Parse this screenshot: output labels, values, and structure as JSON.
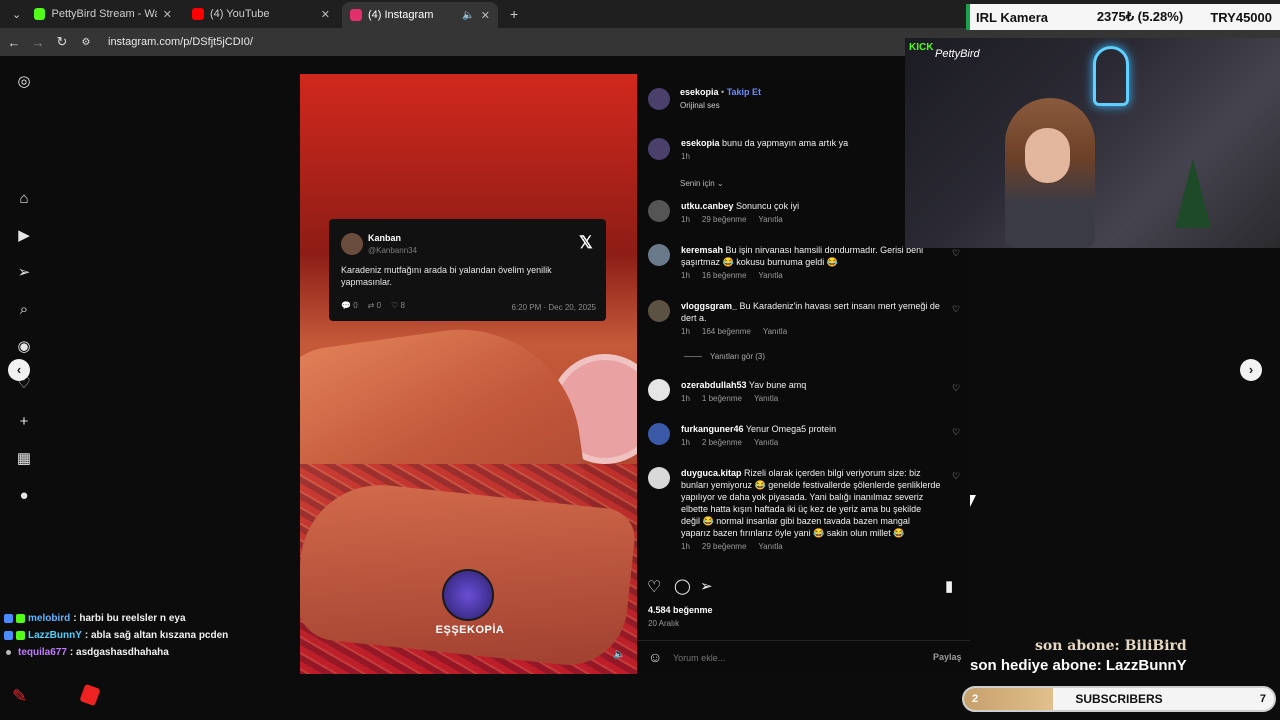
{
  "browser": {
    "tabs": [
      {
        "label": "PettyBird Stream - Watch Live o",
        "favicon_color": "#53fc18",
        "active": false
      },
      {
        "label": "(4) YouTube",
        "favicon_color": "#ff0000",
        "active": false
      },
      {
        "label": "(4) Instagram",
        "favicon_color": "#e1306c",
        "active": true
      }
    ],
    "url": "instagram.com/p/DSfjt5jCDI0/",
    "new_tab": "+"
  },
  "overlay": {
    "irl_label": "IRL Kamera",
    "irl_value": "2375₺ (5.28%)",
    "irl_goal": "TRY45000",
    "cam_brand": "KICK",
    "cam_signature": "PettyBird",
    "last_sub": "son abone: BiliBird",
    "last_gift": "son hediye abone: LazzBunnY",
    "subbar": {
      "label": "SUBSCRIBERS",
      "current": "2",
      "goal": "7",
      "fraction": 0.2857
    },
    "chat": [
      {
        "user": "melobird",
        "msg": ": harbi bu reelsler n eya",
        "color": "#5fb4ff"
      },
      {
        "user": "LazzBunnY",
        "msg": ": abla sağ altan kıszana pcden",
        "color": "#4fd0ff"
      },
      {
        "user": "tequila677",
        "msg": ": asdgashasdhahaha",
        "color": "#c07bff"
      }
    ]
  },
  "reel": {
    "tweet": {
      "name": "Kanban",
      "handle": "@Kanbann34",
      "text": "Karadeniz mutfağını arada bi yalandan övelim yenilik yapmasınlar.",
      "replies": "0",
      "retweets": "0",
      "likes": "8",
      "timestamp": "6:20 PM · Dec 20, 2025"
    },
    "watermark": "EŞŞEKOPİA"
  },
  "post": {
    "author": "esekopia",
    "follow": "Takip Et",
    "audio": "Orijinal ses",
    "caption": "bunu da yapmayın ama artık ya",
    "caption_time": "1h",
    "sort_label": "Senin için",
    "comments": [
      {
        "user": "utku.canbey",
        "text": "Sonuncu çok iyi",
        "time": "1h",
        "likes": "29 beğenme",
        "reply": "Yanıtla"
      },
      {
        "user": "keremsah",
        "text": "Bu işin nirvanası hamsili dondurmadır. Gerisi beni şaşırtmaz 😂 kokusu burnuma geldi 😂",
        "time": "1h",
        "likes": "16 beğenme",
        "reply": "Yanıtla"
      },
      {
        "user": "vloggsgram_",
        "text": "Bu Karadeniz'in havası sert insanı mert yemeği de dert a.",
        "time": "1h",
        "likes": "164 beğenme",
        "reply": "Yanıtla"
      },
      {
        "user": "ozerabdullah53",
        "text": "Yav bune amq",
        "time": "1h",
        "likes": "1 beğenme",
        "reply": "Yanıtla"
      },
      {
        "user": "furkanguner46",
        "text": "Yenur Omega5 protein",
        "time": "1h",
        "likes": "2 beğenme",
        "reply": "Yanıtla"
      },
      {
        "user": "duyguca.kitap",
        "text": "Rizeli olarak içerden bilgi veriyorum size: biz bunları yemiyoruz 😂 genelde festivallerde şölenlerde şenliklerde yapılıyor ve daha yok piyasada. Yani balığı inanılmaz severiz elbette hatta kışın haftada iki üç kez de yeriz ama bu şekilde değil 😂 normal insanlar gibi bazen tavada bazen mangal yaparız bazen fırınlarız öyle yani 😂 sakin olun millet 😂",
        "time": "1h",
        "likes": "29 beğenme",
        "reply": "Yanıtla"
      }
    ],
    "view_replies": "Yanıtları gör (3)",
    "likes_total": "4.584 beğenme",
    "date": "20 Aralık",
    "comment_placeholder": "Yorum ekle...",
    "share": "Paylaş"
  }
}
